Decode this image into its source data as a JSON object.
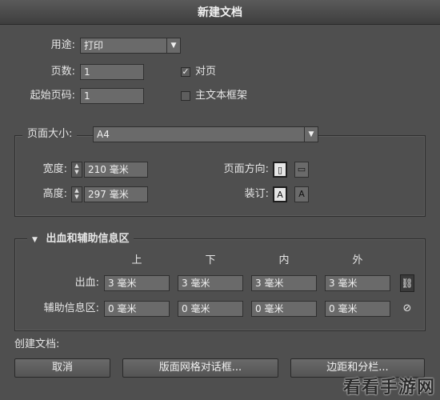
{
  "window": {
    "title": "新建文档"
  },
  "purpose": {
    "label": "用途:",
    "value": "打印"
  },
  "pages": {
    "label": "页数:",
    "value": "1"
  },
  "start_page": {
    "label": "起始页码:",
    "value": "1"
  },
  "facing_pages": {
    "label": "对页",
    "checked": true,
    "check_glyph": "✓"
  },
  "master_text_frame": {
    "label": "主文本框架",
    "checked": false
  },
  "page_size": {
    "label": "页面大小:",
    "value": "A4",
    "width": {
      "label": "宽度:",
      "value": "210 毫米"
    },
    "height": {
      "label": "高度:",
      "value": "297 毫米"
    },
    "orientation": {
      "label": "页面方向:",
      "portrait_glyph": "▯",
      "landscape_glyph": "▭",
      "selected": "portrait"
    },
    "binding": {
      "label": "装订:",
      "left_glyph": "A",
      "right_glyph": "A",
      "selected": "left"
    }
  },
  "bleed_slug": {
    "title": "出血和辅助信息区",
    "columns": [
      "上",
      "下",
      "内",
      "外"
    ],
    "bleed": {
      "label": "出血:",
      "values": [
        "3 毫米",
        "3 毫米",
        "3 毫米",
        "3 毫米"
      ],
      "linked": true
    },
    "slug": {
      "label": "辅助信息区:",
      "values": [
        "0 毫米",
        "0 毫米",
        "0 毫米",
        "0 毫米"
      ],
      "linked": false
    }
  },
  "create_label": "创建文档:",
  "buttons": {
    "cancel": "取消",
    "layout_grid": "版面网格对话框...",
    "margins_columns": "边距和分栏..."
  },
  "watermark": "看看手游网"
}
